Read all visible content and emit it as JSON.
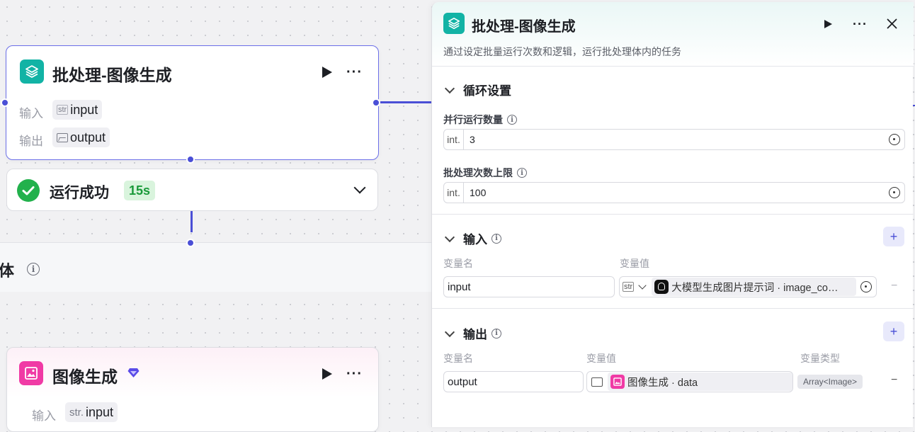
{
  "canvas": {
    "batch_node": {
      "title": "批处理-图像生成",
      "input_label": "输入",
      "input_type": "str",
      "input_name": "input",
      "output_label": "输出",
      "output_name": "output"
    },
    "status": {
      "text": "运行成功",
      "duration": "15s"
    },
    "group": {
      "title_partial": "体"
    },
    "image_node": {
      "title": "图像生成",
      "input_label": "输入",
      "input_type": "str.",
      "input_name": "input"
    }
  },
  "panel": {
    "title": "批处理-图像生成",
    "description": "通过设定批量运行次数和逻辑，运行批处理体内的任务",
    "loop_section": {
      "title": "循环设置",
      "parallel_label": "并行运行数量",
      "parallel_type": "int.",
      "parallel_value": "3",
      "limit_label": "批处理次数上限",
      "limit_type": "int.",
      "limit_value": "100"
    },
    "input_section": {
      "title": "输入",
      "col_name": "变量名",
      "col_value": "变量值",
      "var_name": "input",
      "var_type": "str",
      "var_ref": "大模型生成图片提示词 · image_co…"
    },
    "output_section": {
      "title": "输出",
      "col_name": "变量名",
      "col_value": "变量值",
      "col_type": "变量类型",
      "var_name": "output",
      "var_ref": "图像生成 · data",
      "var_type": "Array<Image>"
    }
  },
  "colors": {
    "accent": "#4a4fd6",
    "teal": "#12b3a5",
    "pink": "#f03aa5",
    "success": "#22b14c"
  }
}
